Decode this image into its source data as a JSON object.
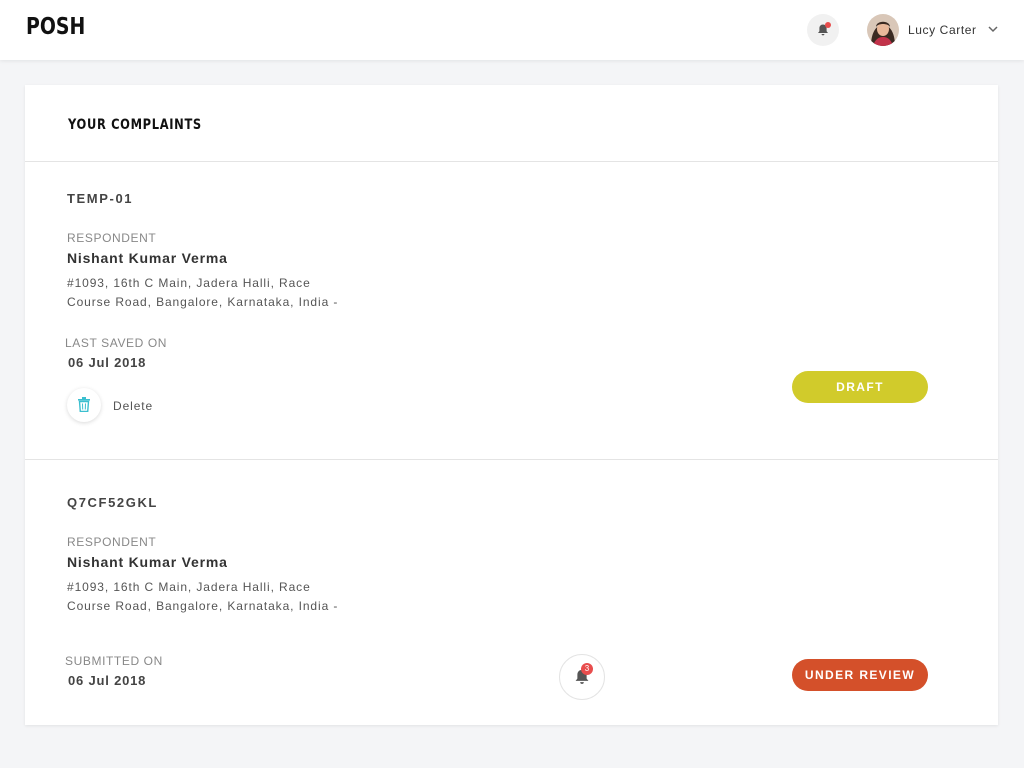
{
  "header": {
    "logo": "POSH",
    "user_name": "Lucy Carter"
  },
  "page": {
    "title": "YOUR COMPLAINTS"
  },
  "complaints": [
    {
      "id": "TEMP-01",
      "respondent_label": "RESPONDENT",
      "respondent_name": "Nishant Kumar Verma",
      "address_line1": "#1093, 16th C Main, Jadera Halli, Race",
      "address_line2": "Course Road, Bangalore, Karnataka, India -",
      "date_label": "LAST SAVED ON",
      "date": "06 Jul 2018",
      "status": "DRAFT",
      "status_color": "#d1cb2b",
      "delete_label": "Delete"
    },
    {
      "id": "Q7CF52GKL",
      "respondent_label": "RESPONDENT",
      "respondent_name": "Nishant Kumar Verma",
      "address_line1": "#1093, 16th C Main, Jadera Halli, Race",
      "address_line2": "Course Road, Bangalore, Karnataka, India -",
      "date_label": "SUBMITTED ON",
      "date": "06 Jul 2018",
      "status": "UNDER REVIEW",
      "status_color": "#d4502a",
      "notification_count": "3"
    }
  ],
  "colors": {
    "accent_trash": "#3bbfcf",
    "notification_dot": "#e84d4d",
    "background": "#f4f5f7"
  },
  "icons": {
    "header_notification": "bell-icon",
    "user_menu": "chevron-down-icon",
    "delete": "trash-icon",
    "complaint_notification": "bell-icon"
  }
}
